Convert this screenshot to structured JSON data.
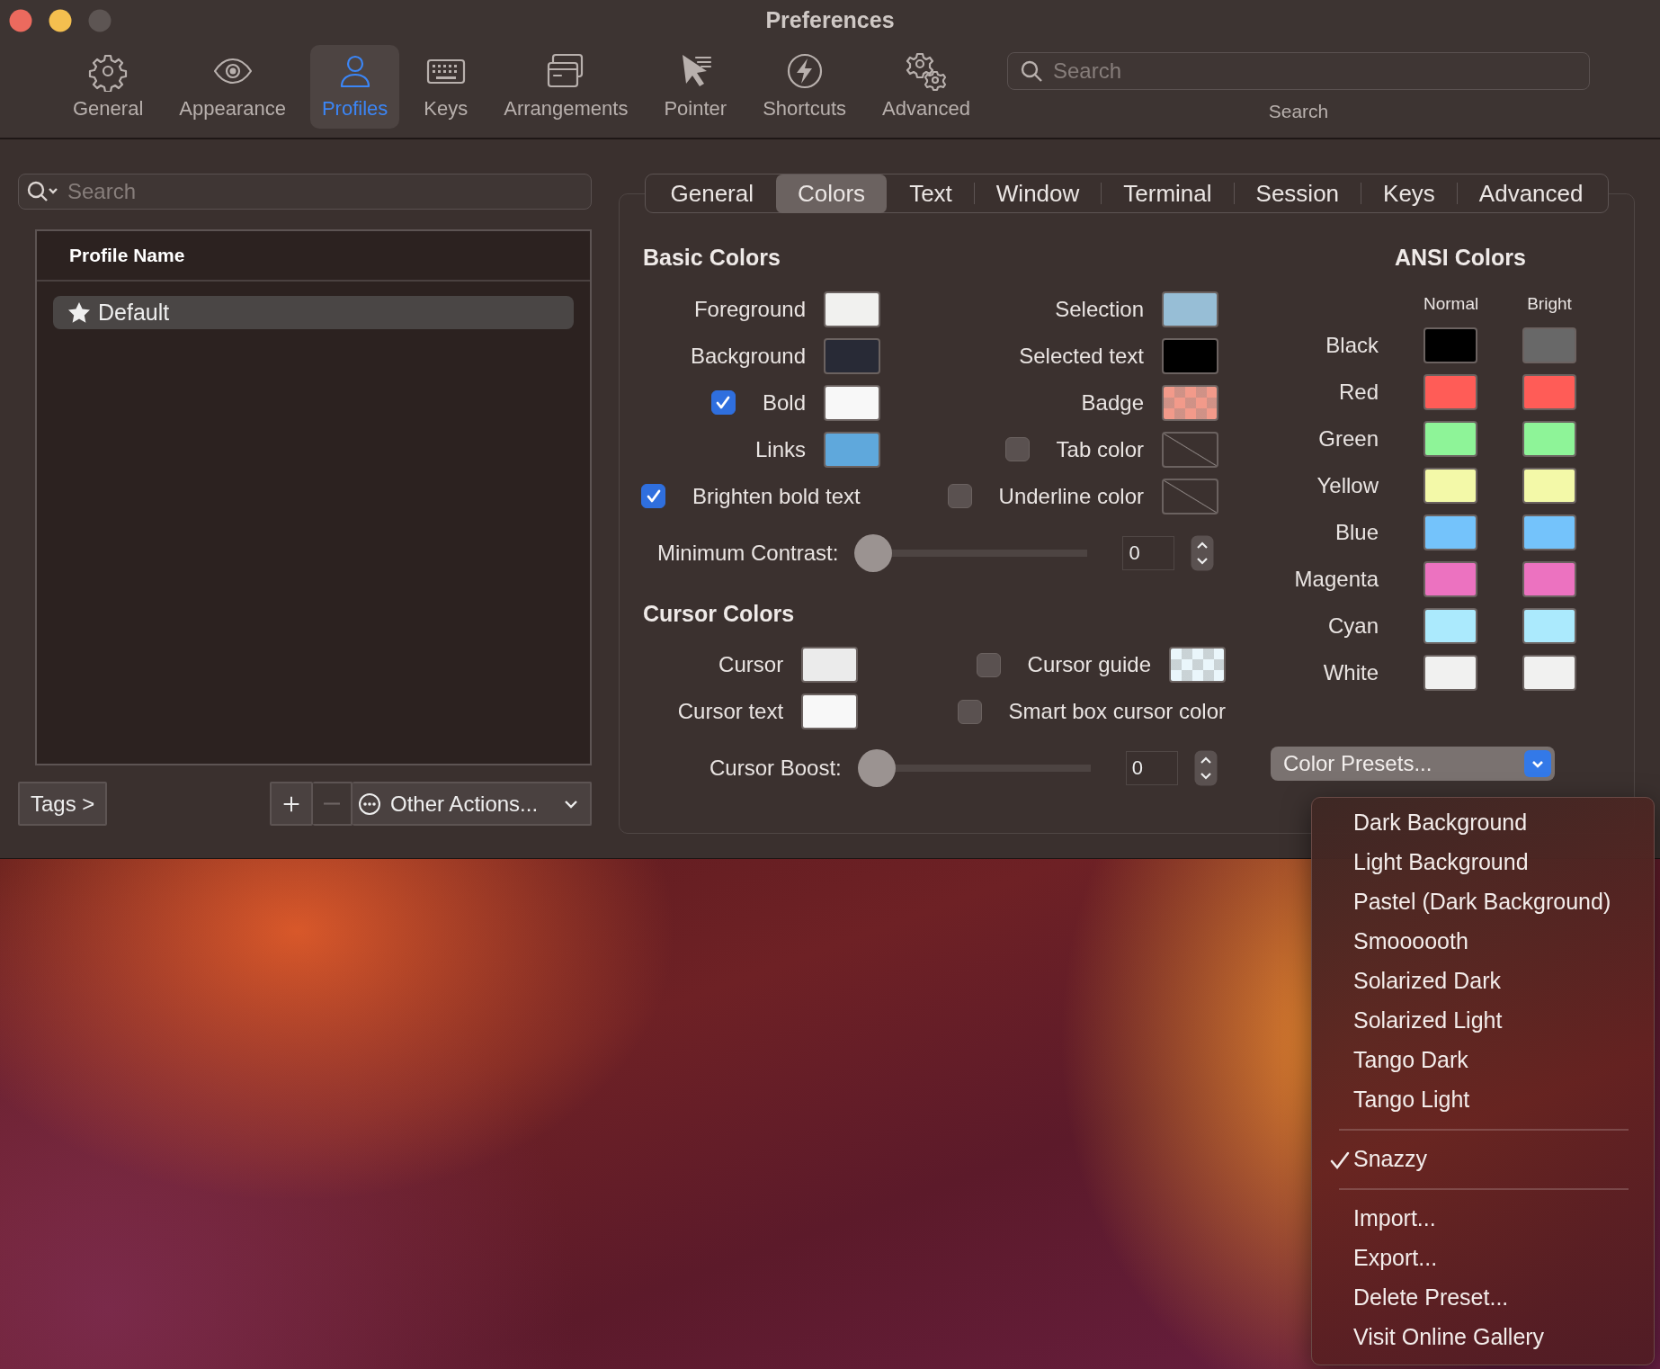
{
  "window": {
    "title": "Preferences"
  },
  "toolbar": {
    "items": [
      {
        "label": "General",
        "selected": false
      },
      {
        "label": "Appearance",
        "selected": false
      },
      {
        "label": "Profiles",
        "selected": true
      },
      {
        "label": "Keys",
        "selected": false
      },
      {
        "label": "Arrangements",
        "selected": false
      },
      {
        "label": "Pointer",
        "selected": false
      },
      {
        "label": "Shortcuts",
        "selected": false
      },
      {
        "label": "Advanced",
        "selected": false
      }
    ],
    "search": {
      "placeholder": "Search",
      "label": "Search"
    }
  },
  "profiles": {
    "search": {
      "placeholder": "Search"
    },
    "column": "Profile Name",
    "rows": [
      {
        "name": "Default",
        "selected": true
      }
    ],
    "tags_button": "Tags >",
    "remove_disabled": true,
    "other_actions": "Other Actions..."
  },
  "profile_tabs": [
    {
      "label": "General",
      "selected": false
    },
    {
      "label": "Colors",
      "selected": true
    },
    {
      "label": "Text",
      "selected": false
    },
    {
      "label": "Window",
      "selected": false
    },
    {
      "label": "Terminal",
      "selected": false
    },
    {
      "label": "Session",
      "selected": false
    },
    {
      "label": "Keys",
      "selected": false
    },
    {
      "label": "Advanced",
      "selected": false
    }
  ],
  "basic_colors": {
    "title": "Basic Colors",
    "left": [
      {
        "kind": "color",
        "label": "Foreground",
        "transparent": false,
        "color": "#f1f1ef"
      },
      {
        "kind": "color",
        "label": "Background",
        "transparent": false,
        "color": "#282a36"
      },
      {
        "kind": "check_color",
        "label": "Bold",
        "checked": true,
        "transparent": false,
        "color": "#f8f8f8"
      },
      {
        "kind": "color",
        "label": "Links",
        "transparent": false,
        "color": "#5fa8dc"
      },
      {
        "kind": "check",
        "label": "Brighten bold text",
        "checked": true
      }
    ],
    "right": [
      {
        "kind": "color",
        "label": "Selection",
        "transparent": false,
        "color": "#97bed6"
      },
      {
        "kind": "color",
        "label": "Selected text",
        "transparent": false,
        "color": "#000000"
      },
      {
        "kind": "color",
        "label": "Badge",
        "transparent": true,
        "color": "#f29a8a"
      },
      {
        "kind": "check_color",
        "label": "Tab color",
        "checked": false
      },
      {
        "kind": "check_color",
        "label": "Underline color",
        "checked": false
      }
    ],
    "slider": {
      "label": "Minimum Contrast:",
      "level": 0,
      "value": "0"
    }
  },
  "cursor_colors": {
    "title": "Cursor Colors",
    "left": [
      {
        "kind": "color",
        "label": "Cursor",
        "transparent": false,
        "color": "#ebebeb"
      },
      {
        "kind": "color",
        "label": "Cursor text",
        "transparent": false,
        "color": "#f8f8f8"
      }
    ],
    "right": [
      {
        "kind": "check_color",
        "label": "Cursor guide",
        "checked": false,
        "transparent": true,
        "color": "#eaf6fb"
      },
      {
        "kind": "check",
        "label": "Smart box cursor color",
        "checked": false
      }
    ],
    "slider": {
      "label": "Cursor Boost:",
      "level": 0,
      "value": "0"
    }
  },
  "ansi": {
    "title": "ANSI Colors",
    "columns": [
      "Normal",
      "Bright"
    ],
    "rows": [
      {
        "label": "Black",
        "normal": {
          "color": "#000000"
        },
        "bright": {
          "color": "#686868"
        }
      },
      {
        "label": "Red",
        "normal": {
          "color": "#ff5c57"
        },
        "bright": {
          "color": "#ff5c57"
        }
      },
      {
        "label": "Green",
        "normal": {
          "color": "#8ef498"
        },
        "bright": {
          "color": "#8ef498"
        }
      },
      {
        "label": "Yellow",
        "normal": {
          "color": "#f3f9a8"
        },
        "bright": {
          "color": "#f3f9a8"
        }
      },
      {
        "label": "Blue",
        "normal": {
          "color": "#74c3fb"
        },
        "bright": {
          "color": "#74c3fb"
        }
      },
      {
        "label": "Magenta",
        "normal": {
          "color": "#ec72c0"
        },
        "bright": {
          "color": "#ec72c0"
        }
      },
      {
        "label": "Cyan",
        "normal": {
          "color": "#abeafd"
        },
        "bright": {
          "color": "#abeafd"
        }
      },
      {
        "label": "White",
        "normal": {
          "color": "#f1f1f0"
        },
        "bright": {
          "color": "#f1f1f0"
        }
      }
    ]
  },
  "color_presets": {
    "label": "Color Presets...",
    "menu": [
      [
        {
          "label": "Dark Background",
          "checked": false
        },
        {
          "label": "Light Background",
          "checked": false
        },
        {
          "label": "Pastel (Dark Background)",
          "checked": false
        },
        {
          "label": "Smoooooth",
          "checked": false
        },
        {
          "label": "Solarized Dark",
          "checked": false
        },
        {
          "label": "Solarized Light",
          "checked": false
        },
        {
          "label": "Tango Dark",
          "checked": false
        },
        {
          "label": "Tango Light",
          "checked": false
        }
      ],
      [
        {
          "label": "Snazzy",
          "checked": true
        }
      ],
      [
        {
          "label": "Import...",
          "checked": false
        },
        {
          "label": "Export...",
          "checked": false
        },
        {
          "label": "Delete Preset...",
          "checked": false
        },
        {
          "label": "Visit Online Gallery",
          "checked": false
        }
      ]
    ]
  }
}
